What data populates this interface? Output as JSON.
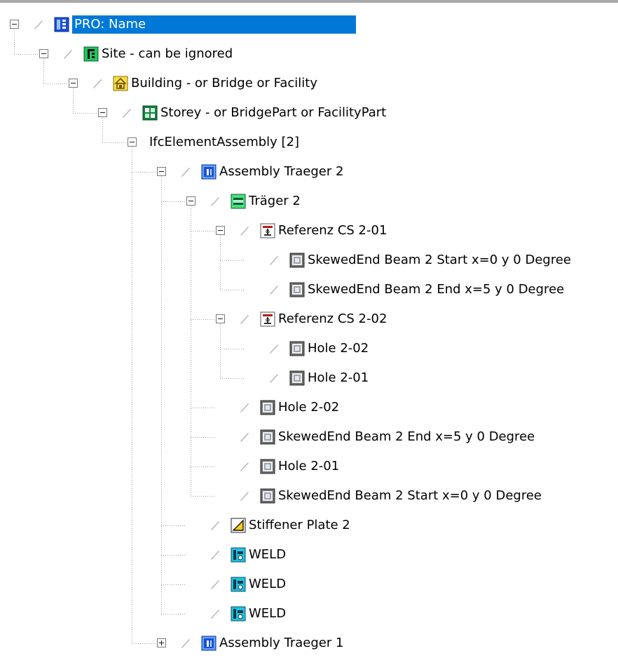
{
  "tree": {
    "nodes": [
      {
        "label": "PRO: Name",
        "icon": "project-icon",
        "level": 0,
        "toggle": "minus",
        "selected": true
      },
      {
        "label": "Site - can be ignored",
        "icon": "site-icon",
        "level": 1,
        "toggle": "minus"
      },
      {
        "label": "Building - or Bridge or Facility",
        "icon": "building-icon",
        "level": 2,
        "toggle": "minus"
      },
      {
        "label": "Storey - or BridgePart or FacilityPart",
        "icon": "storey-icon",
        "level": 3,
        "toggle": "minus"
      },
      {
        "label": "IfcElementAssembly [2]",
        "icon": "",
        "level": 4,
        "toggle": "minus"
      },
      {
        "label": "Assembly Traeger 2",
        "icon": "assembly-icon",
        "level": 5,
        "toggle": "minus"
      },
      {
        "label": "Träger 2",
        "icon": "beam-icon",
        "level": 6,
        "toggle": "minus"
      },
      {
        "label": "Referenz CS 2-01",
        "icon": "reference-cs-icon",
        "level": 7,
        "toggle": "minus"
      },
      {
        "label": "SkewedEnd Beam 2 Start x=0 y 0 Degree",
        "icon": "opening-icon",
        "level": 8,
        "toggle": ""
      },
      {
        "label": "SkewedEnd Beam 2 End x=5 y 0 Degree",
        "icon": "opening-icon",
        "level": 8,
        "toggle": ""
      },
      {
        "label": "Referenz CS 2-02",
        "icon": "reference-cs-icon",
        "level": 7,
        "toggle": "minus"
      },
      {
        "label": "Hole 2-02",
        "icon": "opening-icon",
        "level": 8,
        "toggle": ""
      },
      {
        "label": "Hole 2-01",
        "icon": "opening-icon",
        "level": 8,
        "toggle": ""
      },
      {
        "label": "Hole 2-02",
        "icon": "opening-icon",
        "level": 7,
        "toggle": ""
      },
      {
        "label": "SkewedEnd Beam 2 End x=5 y 0 Degree",
        "icon": "opening-icon",
        "level": 7,
        "toggle": ""
      },
      {
        "label": "Hole 2-01",
        "icon": "opening-icon",
        "level": 7,
        "toggle": ""
      },
      {
        "label": "SkewedEnd Beam 2 Start x=0 y 0 Degree",
        "icon": "opening-icon",
        "level": 7,
        "toggle": ""
      },
      {
        "label": "Stiffener Plate 2",
        "icon": "plate-icon",
        "level": 6,
        "toggle": ""
      },
      {
        "label": "WELD",
        "icon": "weld-icon",
        "level": 6,
        "toggle": ""
      },
      {
        "label": "WELD",
        "icon": "weld-icon",
        "level": 6,
        "toggle": ""
      },
      {
        "label": "WELD",
        "icon": "weld-icon",
        "level": 6,
        "toggle": ""
      },
      {
        "label": "Assembly Traeger 1",
        "icon": "assembly-icon",
        "level": 5,
        "toggle": "plus"
      }
    ]
  },
  "colors": {
    "selection": "#0078d7",
    "connector": "#a0a0a0",
    "site_green": "#22c55e",
    "building_yellow": "#f5e04a",
    "storey_green": "#15803d",
    "assembly_blue": "#1d4ed8",
    "weld_cyan": "#22c1e0"
  }
}
